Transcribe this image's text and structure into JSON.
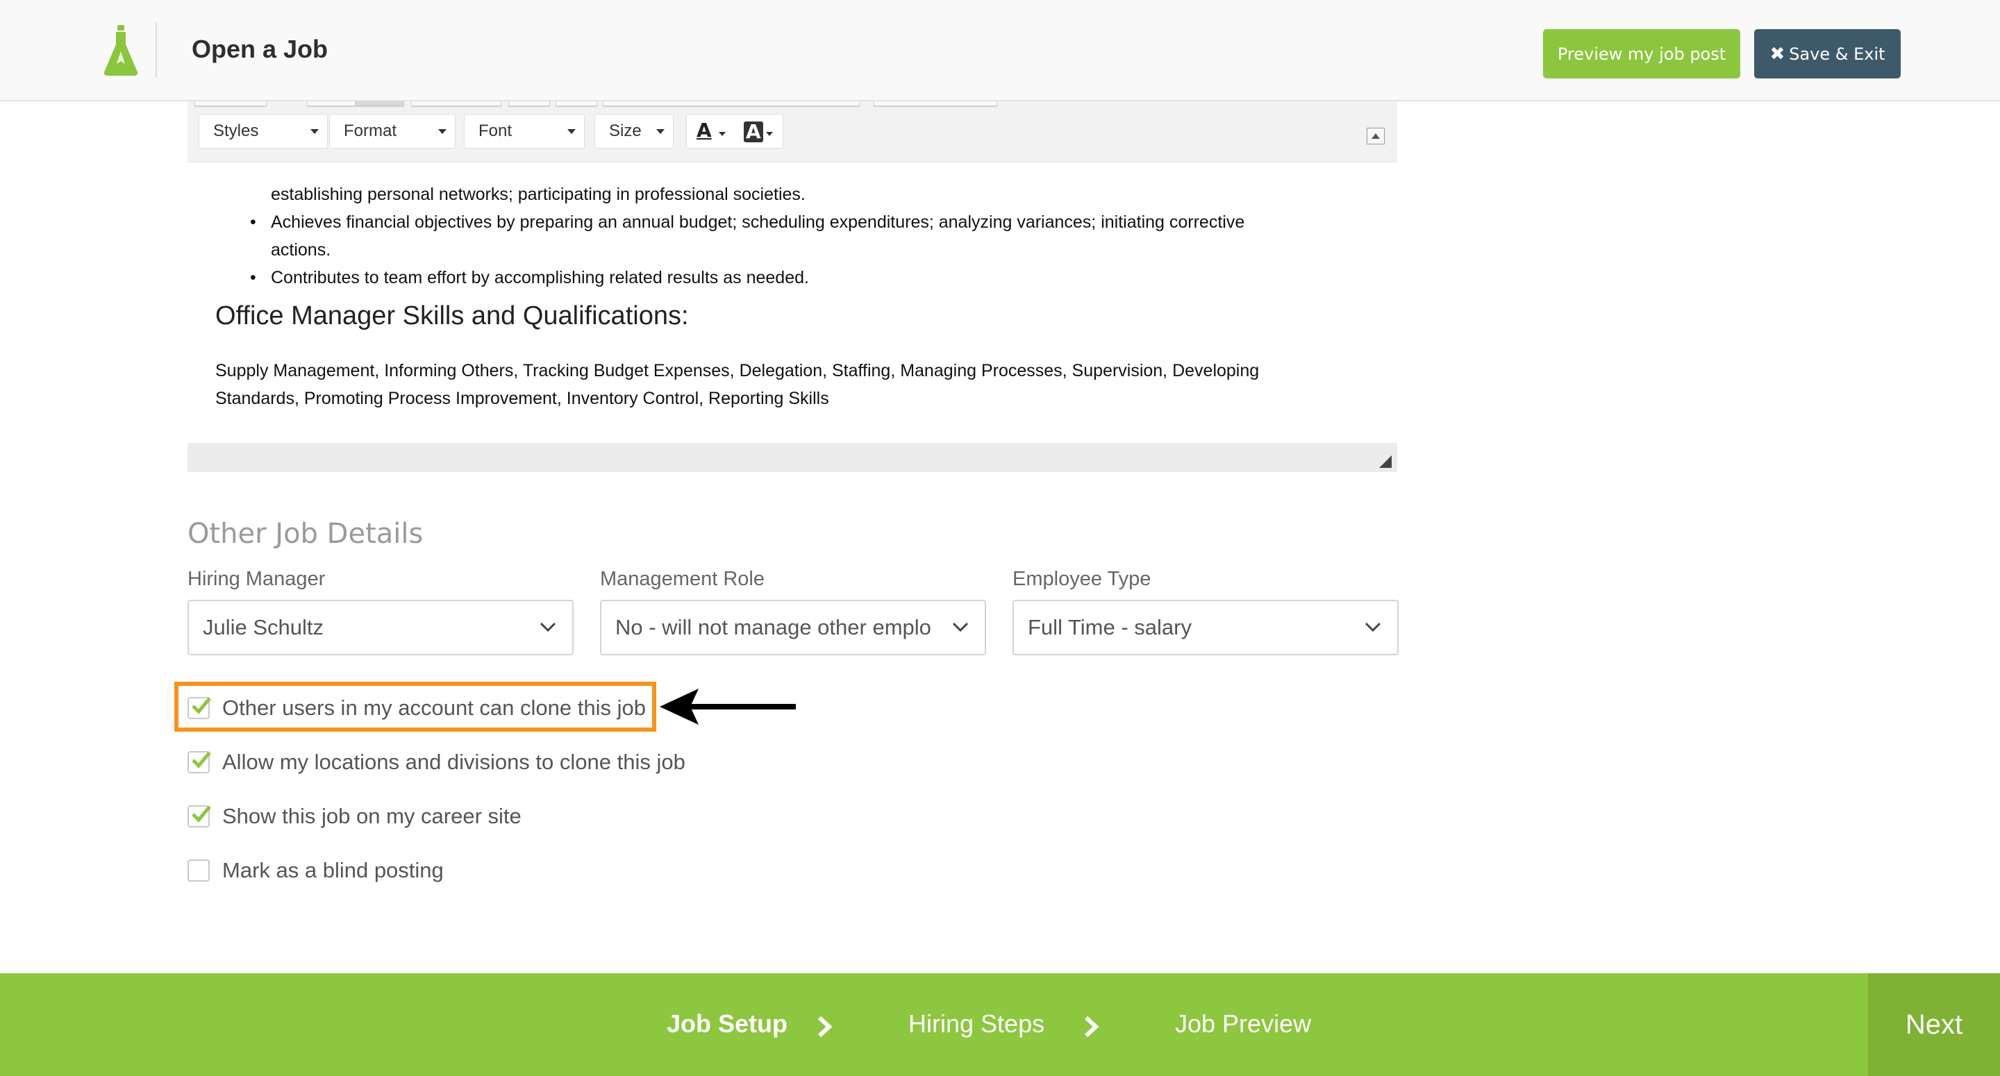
{
  "header": {
    "title": "Open a Job",
    "preview_label": "Preview my job post",
    "save_exit_label": "Save & Exit",
    "logo_icon": "flask-icon",
    "brand_color": "#8cc63f",
    "save_button_color": "#3e5a6a"
  },
  "editor": {
    "toolbar": {
      "styles_label": "Styles",
      "format_label": "Format",
      "font_label": "Font",
      "size_label": "Size",
      "text_color_icon": "text-color-icon",
      "background_color_icon": "background-color-icon"
    },
    "bullets": [
      "Achieves financial objectives by preparing an annual budget; scheduling expenditures; analyzing variances; initiating corrective actions.",
      "Contributes to team effort by accomplishing related results as needed."
    ],
    "partial_bullet_tail": "establishing personal networks; participating in professional societies.",
    "skills_heading": "Office Manager Skills and Qualifications:",
    "skills_text": "Supply Management, Informing Others, Tracking Budget Expenses, Delegation, Staffing, Managing Processes, Supervision, Developing Standards, Promoting Process Improvement, Inventory Control, Reporting Skills"
  },
  "details": {
    "section_title": "Other Job Details",
    "hiring_manager": {
      "label": "Hiring Manager",
      "value": "Julie Schultz"
    },
    "management_role": {
      "label": "Management Role",
      "value": "No - will not manage other emplo"
    },
    "employee_type": {
      "label": "Employee Type",
      "value": "Full Time - salary"
    },
    "checkboxes": [
      {
        "label": "Other users in my account can clone this job",
        "checked": true
      },
      {
        "label": "Allow my locations and divisions to clone this job",
        "checked": true
      },
      {
        "label": "Show this job on my career site",
        "checked": true
      },
      {
        "label": "Mark as a blind posting",
        "checked": false
      }
    ],
    "highlight_color": "#f7931e"
  },
  "footer": {
    "steps": [
      "Job Setup",
      "Hiring Steps",
      "Job Preview"
    ],
    "active_step": "Job Setup",
    "next_label": "Next",
    "footer_color": "#8dc63f"
  }
}
